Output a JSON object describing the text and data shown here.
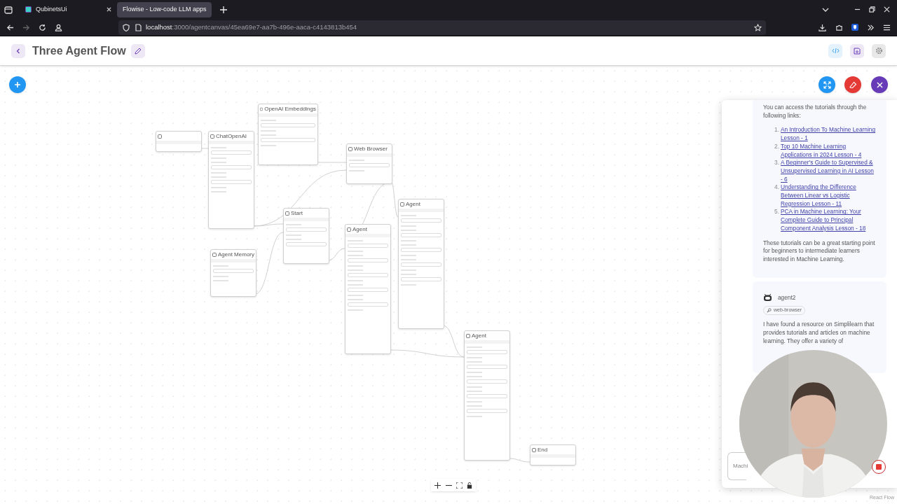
{
  "browser": {
    "tabs": [
      {
        "title": "QubinetsUi",
        "selected": false
      },
      {
        "title": "Flowise - Low-code LLM apps",
        "selected": true
      }
    ],
    "url_host": "localhost",
    "url_path": ":3000/agentcanvas/45ea69e7-aa7b-496e-aaca-c4143813b454"
  },
  "header": {
    "title": "Three Agent Flow"
  },
  "canvas": {
    "nodes": [
      {
        "kind": "small"
      },
      {
        "kind": "tall",
        "title": "ChatOpenAI"
      },
      {
        "kind": "medium",
        "title": "OpenAI Embeddings"
      },
      {
        "kind": "small",
        "title": "Web Browser"
      },
      {
        "kind": "medium",
        "title": "Start"
      },
      {
        "kind": "medium",
        "title": "Agent Memory"
      },
      {
        "kind": "agent",
        "title": "Agent"
      },
      {
        "kind": "agent",
        "title": "Agent"
      },
      {
        "kind": "agent",
        "title": "Agent"
      },
      {
        "kind": "small",
        "title": "End"
      }
    ]
  },
  "chat": {
    "messages": [
      {
        "kind": "links",
        "intro": "You can access the tutorials through the following links:",
        "links": [
          {
            "number": "1.",
            "text": "An Introduction To Machine Learning Lesson - 1"
          },
          {
            "number": "2.",
            "text": "Top 10 Machine Learning Applications in 2024 Lesson - 4"
          },
          {
            "number": "3.",
            "text": "A Beginner's Guide to Supervised & Unsupervised Learning in AI Lesson - 6"
          },
          {
            "number": "4.",
            "text": "Understanding the Difference Between Linear vs Logistic Regression Lesson - 11"
          },
          {
            "number": "5.",
            "text": "PCA in Machine Learning: Your Complete Guide to Principal Component Analysis Lesson - 18"
          }
        ],
        "outro": "These tutorials can be a great starting point for beginners to intermediate learners interested in Machine Learning."
      },
      {
        "kind": "agent",
        "agent": "agent2",
        "tool": "web-browser",
        "text": "I have found a resource on Simplilearn that provides tutorials and articles on machine learning. They offer a variety of"
      }
    ],
    "input_value": "Machi"
  },
  "footer": {
    "attribution": "React Flow"
  }
}
